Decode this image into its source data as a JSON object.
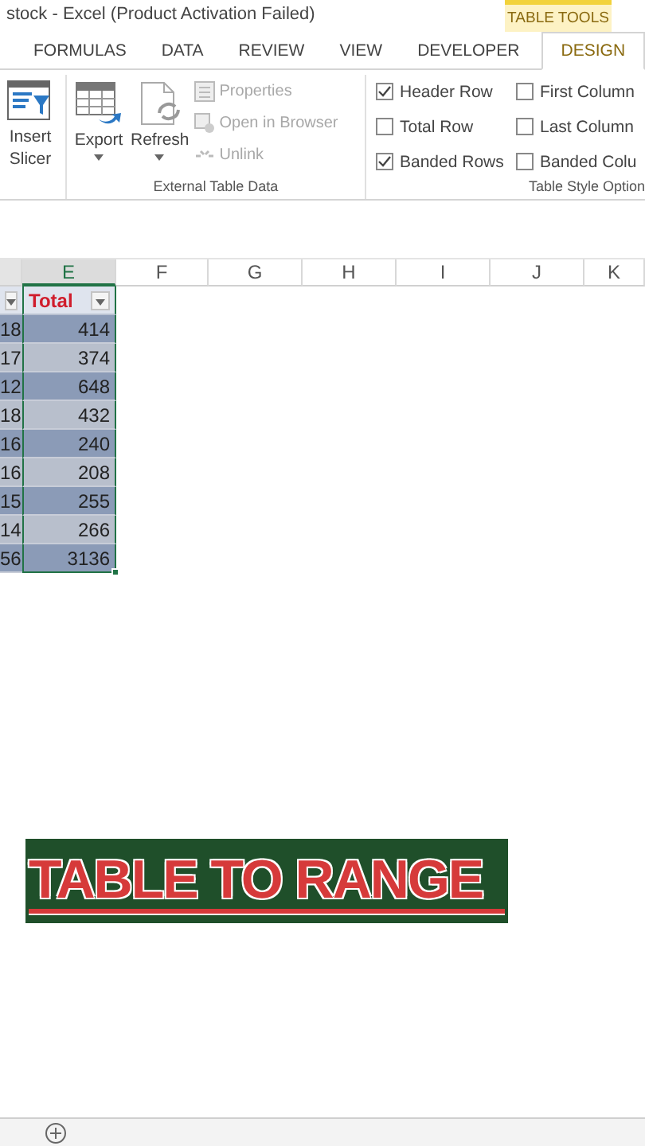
{
  "title_bar": {
    "title": "stock - Excel (Product Activation Failed)",
    "context_label": "TABLE TOOLS"
  },
  "tabs": [
    {
      "label": "FORMULAS",
      "selected": false
    },
    {
      "label": "DATA",
      "selected": false
    },
    {
      "label": "REVIEW",
      "selected": false
    },
    {
      "label": "VIEW",
      "selected": false
    },
    {
      "label": "DEVELOPER",
      "selected": false
    },
    {
      "label": "DESIGN",
      "selected": true
    }
  ],
  "ribbon": {
    "slicer_button": {
      "lines": [
        "Insert",
        "Slicer"
      ]
    },
    "external_table_data": {
      "title": "External Table Data",
      "big_buttons": [
        {
          "label": "Export",
          "kind": "export"
        },
        {
          "label": "Refresh",
          "kind": "refresh"
        }
      ],
      "small_buttons": [
        {
          "label": "Properties",
          "kind": "properties",
          "disabled": true
        },
        {
          "label": "Open in Browser",
          "kind": "browser",
          "disabled": true
        },
        {
          "label": "Unlink",
          "kind": "unlink",
          "disabled": true
        }
      ]
    },
    "table_style_options": {
      "title": "Table Style Option",
      "options": [
        {
          "label": "Header Row",
          "checked": true
        },
        {
          "label": "Total Row",
          "checked": false
        },
        {
          "label": "Banded Rows",
          "checked": true
        },
        {
          "label": "First Column",
          "checked": false
        },
        {
          "label": "Last Column",
          "checked": false
        },
        {
          "label": "Banded Colu",
          "checked": false
        }
      ]
    }
  },
  "sheet": {
    "columns": [
      {
        "selected": false
      },
      {
        "label": "E",
        "selected": true
      },
      {
        "label": "F",
        "selected": false
      },
      {
        "label": "G",
        "selected": false
      },
      {
        "label": "H",
        "selected": false
      },
      {
        "label": "I",
        "selected": false
      },
      {
        "label": "J",
        "selected": false
      },
      {
        "label": "K",
        "selected": false
      }
    ],
    "table": {
      "header_cells": [
        {
          "filter_button": true
        },
        {
          "text": "Total",
          "filter_button": true
        }
      ],
      "rows": [
        [
          "18",
          "414"
        ],
        [
          "17",
          "374"
        ],
        [
          "12",
          "648"
        ],
        [
          "18",
          "432"
        ],
        [
          "16",
          "240"
        ],
        [
          "16",
          "208"
        ],
        [
          "15",
          "255"
        ],
        [
          "14",
          "266"
        ],
        [
          "56",
          "3136"
        ]
      ]
    }
  },
  "banner": {
    "text": "TABLE TO RANGE"
  }
}
